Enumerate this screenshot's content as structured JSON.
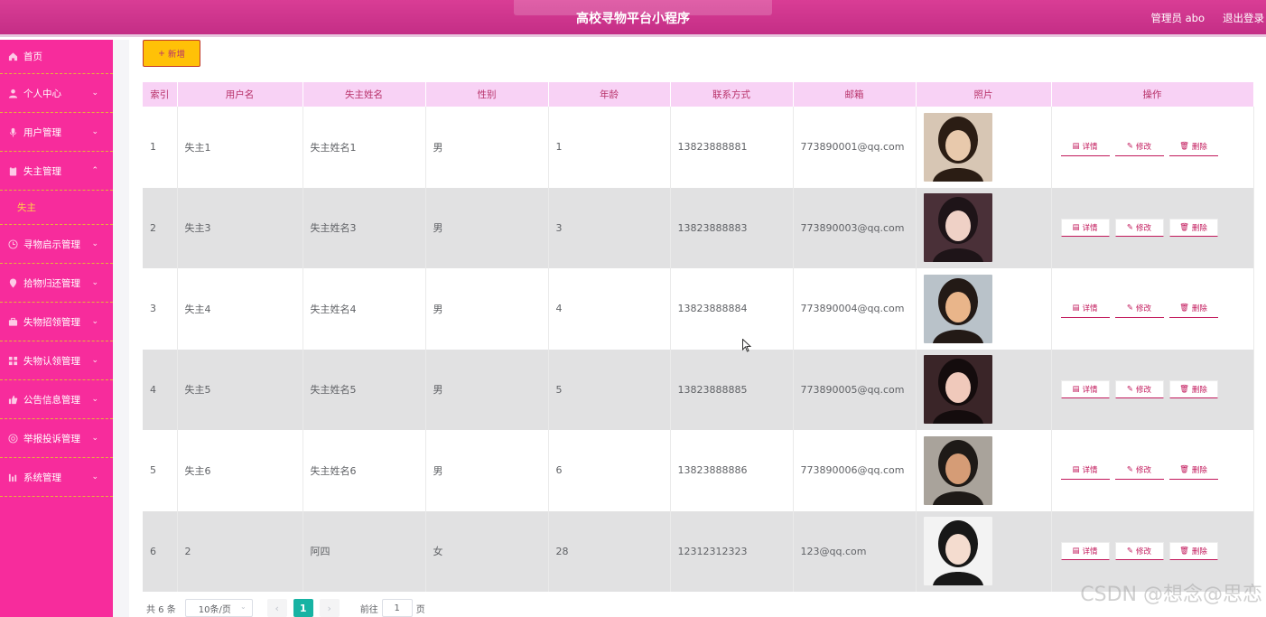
{
  "header": {
    "title": "高校寻物平台小程序",
    "admin_label": "管理员 abo",
    "logout_label": "退出登录"
  },
  "sidebar": {
    "items": [
      {
        "label": "首页",
        "icon": "home-icon",
        "expandable": false
      },
      {
        "label": "个人中心",
        "icon": "user-icon",
        "expandable": true
      },
      {
        "label": "用户管理",
        "icon": "microphone-icon",
        "expandable": true
      },
      {
        "label": "失主管理",
        "icon": "clipboard-icon",
        "expandable": true,
        "expanded": true
      },
      {
        "label": "寻物启示管理",
        "icon": "clock-icon",
        "expandable": true
      },
      {
        "label": "拾物归还管理",
        "icon": "location-icon",
        "expandable": true
      },
      {
        "label": "失物招领管理",
        "icon": "briefcase-icon",
        "expandable": true
      },
      {
        "label": "失物认领管理",
        "icon": "grid-icon",
        "expandable": true
      },
      {
        "label": "公告信息管理",
        "icon": "thumbs-up-icon",
        "expandable": true
      },
      {
        "label": "举报投诉管理",
        "icon": "settings-circle-icon",
        "expandable": true
      },
      {
        "label": "系统管理",
        "icon": "bar-chart-icon",
        "expandable": true
      }
    ],
    "submenu_label": "失主"
  },
  "toolbar": {
    "add_label": "新增"
  },
  "table": {
    "columns": [
      "索引",
      "用户名",
      "失主姓名",
      "性别",
      "年龄",
      "联系方式",
      "邮箱",
      "照片",
      "操作"
    ],
    "rows": [
      {
        "index": "1",
        "username": "失主1",
        "name": "失主姓名1",
        "gender": "男",
        "age": "1",
        "phone": "13823888881",
        "email": "773890001@qq.com",
        "photo": "photo-male-1"
      },
      {
        "index": "2",
        "username": "失主3",
        "name": "失主姓名3",
        "gender": "男",
        "age": "3",
        "phone": "13823888883",
        "email": "773890003@qq.com",
        "photo": "photo-female-1"
      },
      {
        "index": "3",
        "username": "失主4",
        "name": "失主姓名4",
        "gender": "男",
        "age": "4",
        "phone": "13823888884",
        "email": "773890004@qq.com",
        "photo": "photo-female-2"
      },
      {
        "index": "4",
        "username": "失主5",
        "name": "失主姓名5",
        "gender": "男",
        "age": "5",
        "phone": "13823888885",
        "email": "773890005@qq.com",
        "photo": "photo-female-3"
      },
      {
        "index": "5",
        "username": "失主6",
        "name": "失主姓名6",
        "gender": "男",
        "age": "6",
        "phone": "13823888886",
        "email": "773890006@qq.com",
        "photo": "photo-male-2"
      },
      {
        "index": "6",
        "username": "2",
        "name": "阿四",
        "gender": "女",
        "age": "28",
        "phone": "12312312323",
        "email": "123@qq.com",
        "photo": "photo-female-4"
      }
    ],
    "actions": {
      "detail": "详情",
      "edit": "修改",
      "delete": "删除"
    }
  },
  "pagination": {
    "total_label": "共 6 条",
    "page_size_label": "10条/页",
    "current_page": "1",
    "goto_label": "前往",
    "goto_value": "1",
    "page_unit": "页"
  },
  "watermark": "CSDN @想念@思恋",
  "colors": {
    "header": "#c42e86",
    "sidebar": "#f72c9c",
    "table_header": "#f8d2f5",
    "accent": "#c2185b",
    "add_button": "#ffc107",
    "active_page": "#17b3a3"
  }
}
